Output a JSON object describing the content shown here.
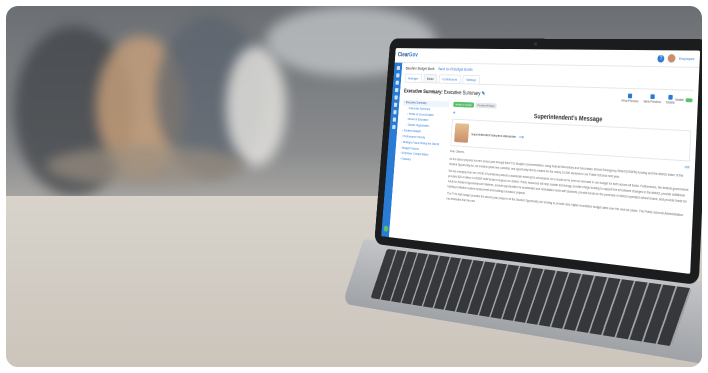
{
  "app": {
    "logo_clear": "Clear",
    "logo_gov": "Gov",
    "user": "Employee",
    "help_icon": "question-icon"
  },
  "breadcrumb": {
    "book": "Baseline Budget Book",
    "back_link": "Back to All Budget Books"
  },
  "tabs": [
    "Manager",
    "Editor",
    "Contributors",
    "Settings"
  ],
  "document": {
    "title": "Executive Summary:",
    "subtitle": "Executive Summary"
  },
  "actions": [
    "Print Preview",
    "Web Preview",
    "Delete"
  ],
  "visibility_label": "Visible",
  "toc": [
    {
      "label": "Executive Summary",
      "level": 0,
      "selected": true
    },
    {
      "label": "Executive Summary",
      "level": 1
    },
    {
      "label": "Profile of School District",
      "level": 1
    },
    {
      "label": "Board of Education",
      "level": 1
    },
    {
      "label": "District Organization",
      "level": 1
    },
    {
      "label": "Student Analysis",
      "level": 0
    },
    {
      "label": "Performance Results",
      "level": 0
    },
    {
      "label": "Strategic Focus Driving the District",
      "level": 0
    },
    {
      "label": "Budget Process",
      "level": 0
    },
    {
      "label": "Employee Compensation",
      "level": 0
    },
    {
      "label": "Glossary",
      "level": 0
    }
  ],
  "chips": [
    "Applied to Header",
    "Preview All Pages"
  ],
  "message": {
    "title": "Superintendent's Message",
    "signer": "Superintendent Maryann Alexander",
    "edit": "edit",
    "greeting": "Dear Citizens,",
    "edit2": "edit"
  },
  "paragraphs": [
    "As the district prepares for next school year through this FY2x Budget recommendation, using federal Elementary and Secondary School Emergency Relief (ESSER) funding and the district share of the Student Opportunity Act, we envision great new, potential, and opportunity that is created for the nearly 10,000 students in our Public Schools next year.",
    "We are emerging from the COVID-19 pandemic poised to accelerate learning for all students. As a result we've seen an increase in our budget for both across all funds. Furthermore, the federal government provided $22.4 million in ESSER relief funds to support our district. These resources will help sustain technology, provide bridge funding to support the enrollment changes in the district, provide additional funds for Student Opportunity Act initiatives, provide opportunities for accelerated and remediation work with students, provide funds for the purchase of district operated school buses, and provide funds for building ventilation system replacement and building renovation projects.",
    "The FY2x draft budget provides the second year phase-in of the Student Opportunity Act funding to provide new, higher foundation budget rates over the next six years. The Public Schools Administration has estimated that the new"
  ]
}
